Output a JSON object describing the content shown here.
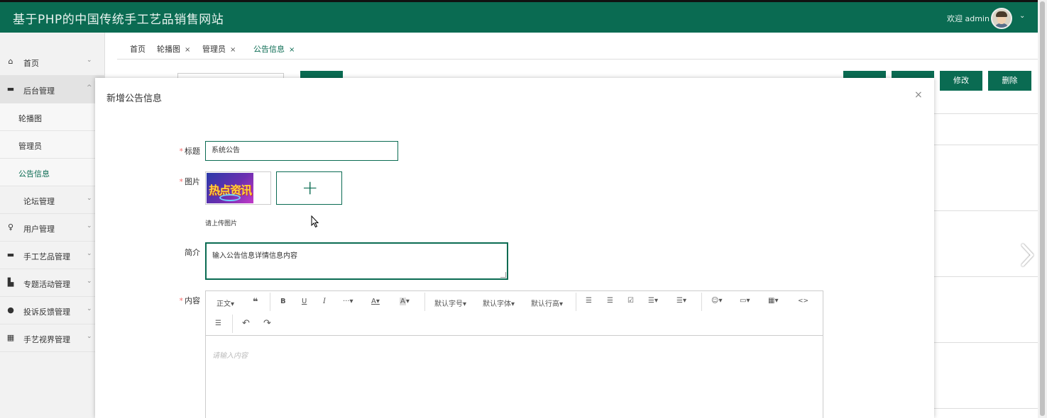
{
  "header": {
    "title": "基于PHP的中国传统手工艺品销售网站",
    "welcome": "欢迎 admin",
    "chevron": "⌄"
  },
  "sidebar": {
    "items": [
      {
        "label": "首页",
        "icon": "home-icon",
        "glyph": "⌂",
        "arrow": "⌄"
      },
      {
        "label": "后台管理",
        "icon": "server-icon",
        "glyph": "▬",
        "arrow": "^"
      },
      {
        "label": "论坛管理",
        "arrow": "⌄"
      },
      {
        "label": "用户管理",
        "icon": "user-icon",
        "glyph": "♀",
        "arrow": "⌄"
      },
      {
        "label": "手工艺品管理",
        "icon": "folder-icon",
        "glyph": "▬",
        "arrow": "⌄"
      },
      {
        "label": "专题活动管理",
        "icon": "chart-icon",
        "glyph": "▙",
        "arrow": "⌄"
      },
      {
        "label": "投诉反馈管理",
        "icon": "circle-icon",
        "glyph": "●",
        "arrow": "⌄"
      },
      {
        "label": "手艺视界管理",
        "icon": "grid-icon",
        "glyph": "▦",
        "arrow": "⌄"
      }
    ],
    "sub_items": [
      {
        "label": "轮播图"
      },
      {
        "label": "管理员"
      },
      {
        "label": "公告信息"
      }
    ]
  },
  "tabs": [
    {
      "label": "首页",
      "close": ""
    },
    {
      "label": "轮播图",
      "close": "×"
    },
    {
      "label": "管理员",
      "close": "×"
    },
    {
      "label": "公告信息",
      "close": "×"
    }
  ],
  "background_buttons": {
    "edit": "修改",
    "delete": "删除"
  },
  "modal": {
    "title": "新增公告信息",
    "close": "×",
    "title_label": "标题",
    "title_value": "系统公告",
    "image_label": "图片",
    "image_text": "热点资讯",
    "upload_plus": "+",
    "upload_tip": "请上传图片",
    "summary_label": "简介",
    "summary_value": "输入公告信息详情信息内容",
    "content_label": "内容",
    "required_mark": "*",
    "editor_placeholder": "请输入内容",
    "toolbar": {
      "paragraph": "正文",
      "quote": "❝",
      "bold": "B",
      "underline": "U",
      "italic": "I",
      "more": "···",
      "font_color": "A",
      "bg_color": "A",
      "font_size": "默认字号",
      "font_family": "默认字体",
      "line_height": "默认行高",
      "bulleted_list": "☰",
      "numbered_list": "☰",
      "todo": "☑",
      "align": "☰",
      "indent": "☰",
      "emoji": "☺",
      "image": "▭",
      "table": "▦",
      "code": "<>",
      "divider": "☰",
      "undo": "↶",
      "redo": "↷",
      "caret": "▾"
    }
  }
}
